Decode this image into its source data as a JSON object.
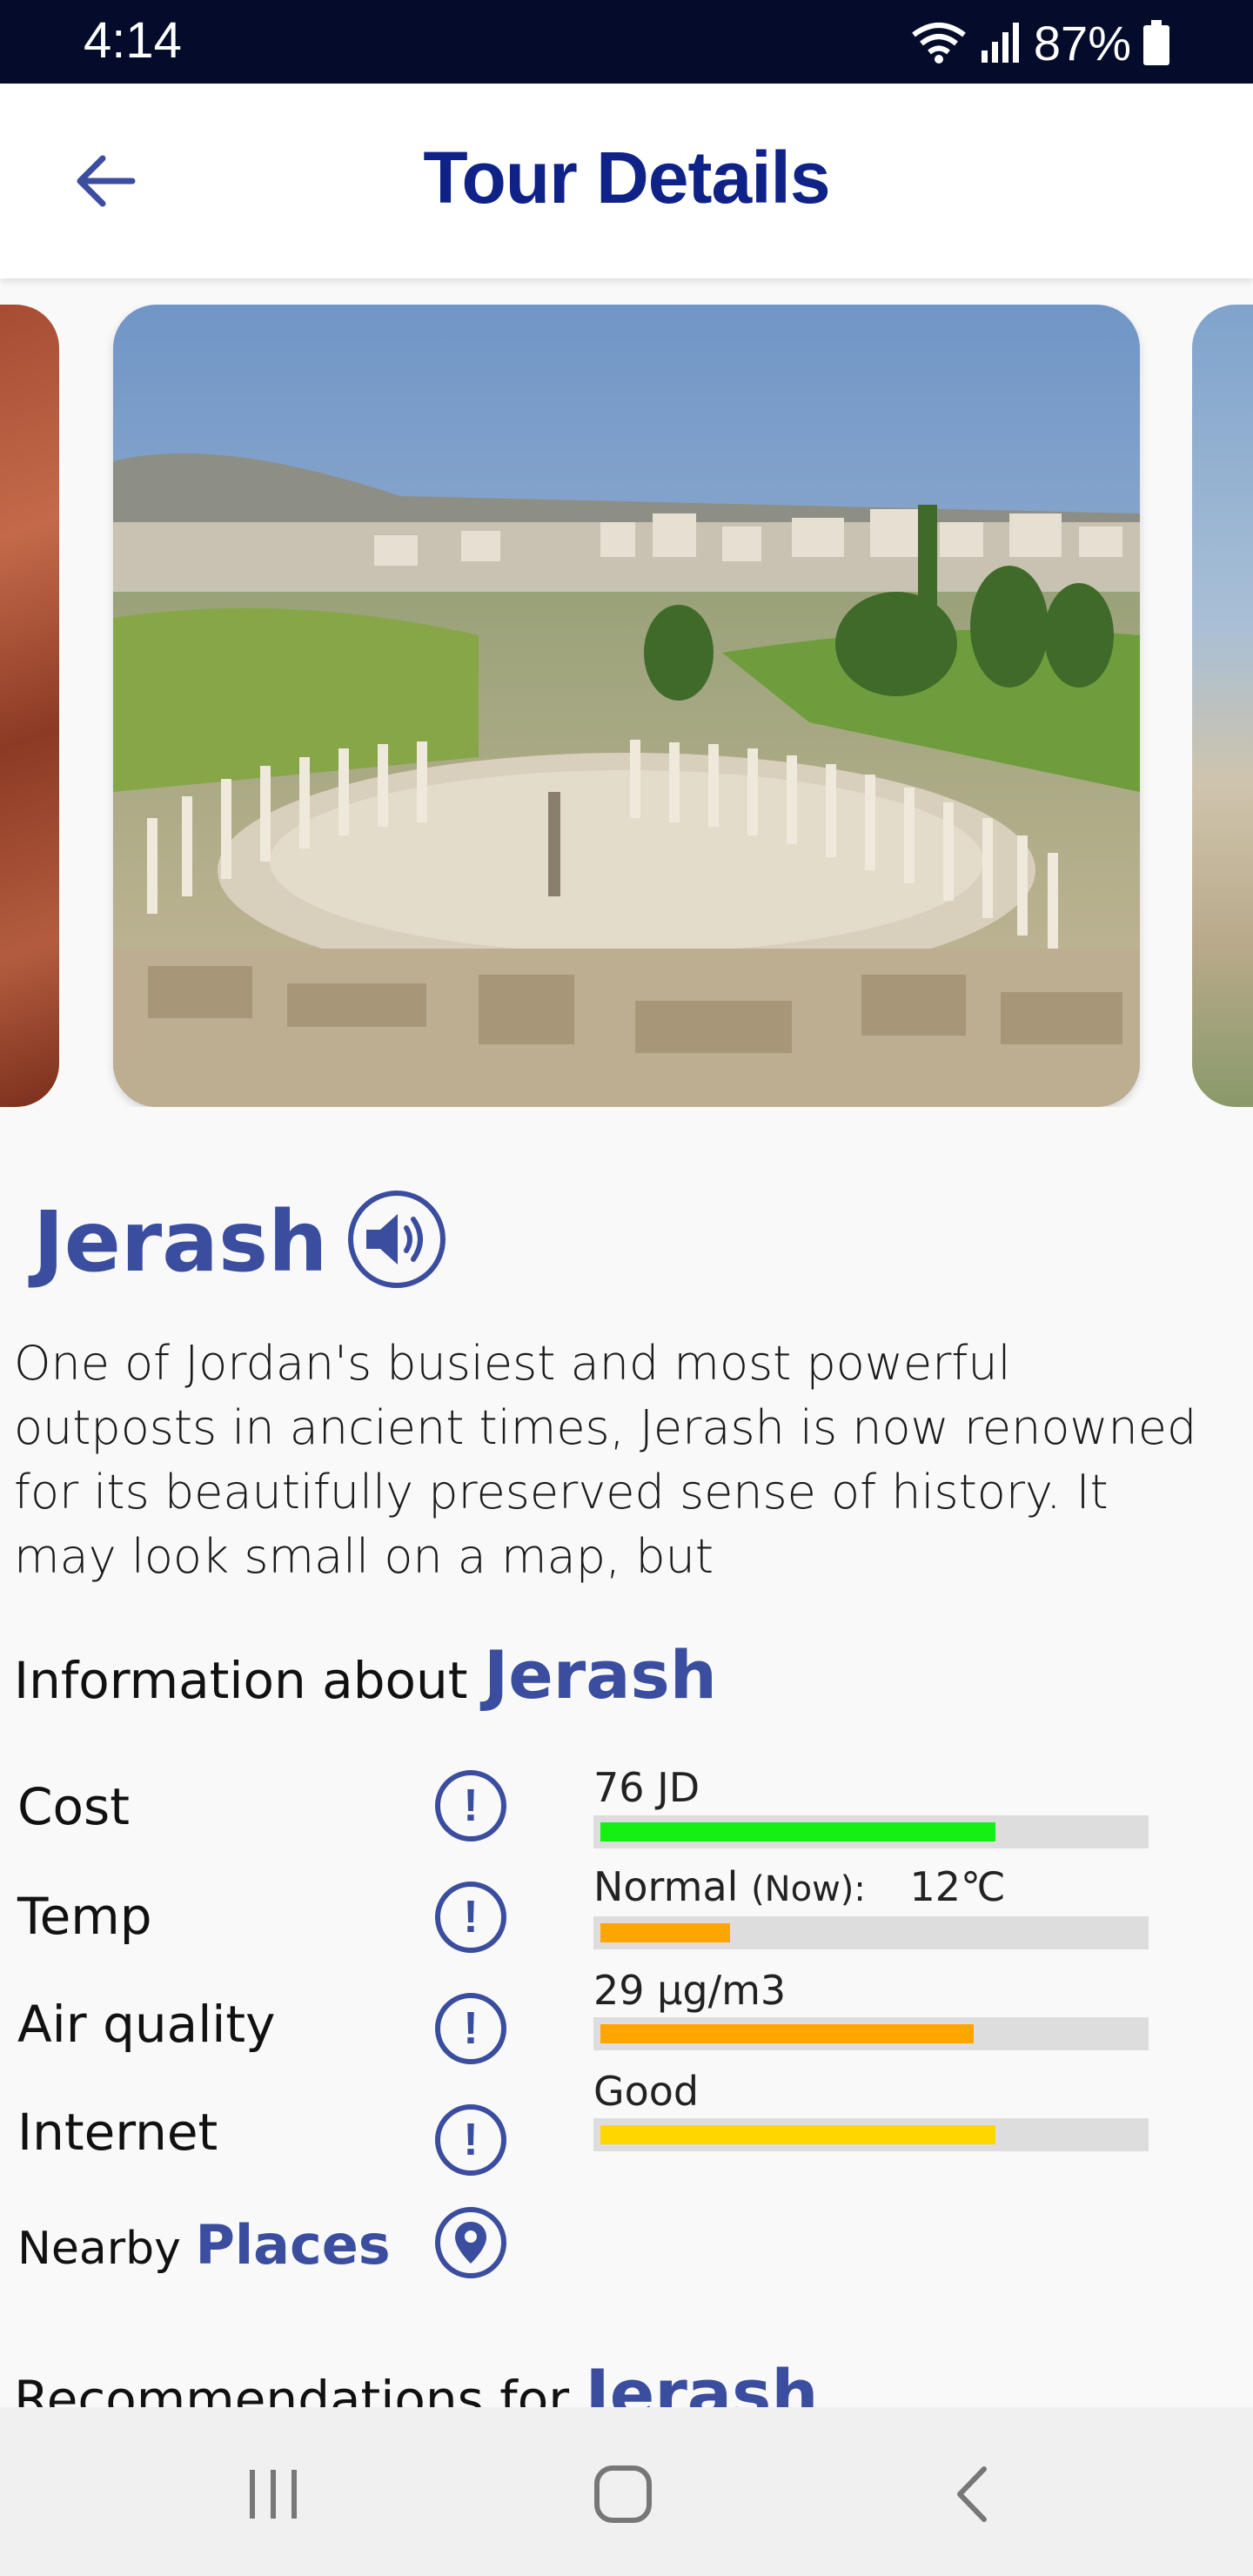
{
  "status_bar": {
    "time": "4:14",
    "battery": "87%"
  },
  "app_bar": {
    "title": "Tour Details"
  },
  "place": {
    "name": "Jerash",
    "description": "One of Jordan's busiest and most powerful outposts in ancient times, Jerash is now renowned for its beautifully preserved sense of history. It may look small on a map, but"
  },
  "info": {
    "heading_prefix": "Information about",
    "heading_place": "Jerash",
    "rows": [
      {
        "label": "Cost",
        "value": "76 JD",
        "level": 0.73,
        "color": "#14f014"
      },
      {
        "label": "Temp",
        "value_prefix": "Normal",
        "value_small": "(Now):",
        "value_suffix": "12℃",
        "level": 0.24,
        "color": "#ffa500"
      },
      {
        "label": "Air quality",
        "value": "29 µg/m3",
        "level": 0.69,
        "color": "#ffa500"
      },
      {
        "label": "Internet",
        "value": "Good",
        "level": 0.73,
        "color": "#ffd700"
      }
    ],
    "nearby_prefix": "Nearby",
    "nearby_accent": "Places"
  },
  "recommendations": {
    "prefix": "Recommendations for",
    "place": "Jerash"
  },
  "colors": {
    "accent": "#3a4d9f",
    "title": "#0f2287",
    "status_bar": "#050b2b"
  }
}
